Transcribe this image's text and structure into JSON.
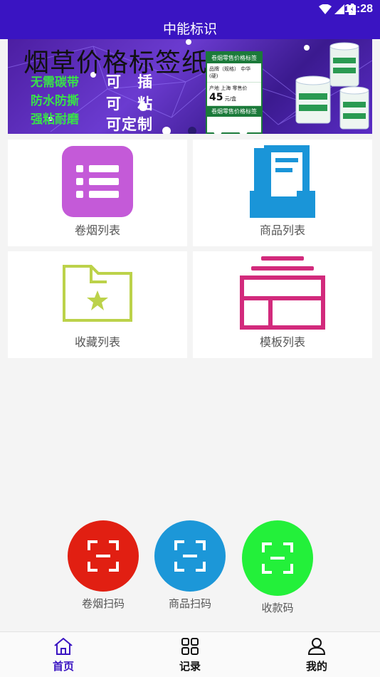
{
  "status_bar": {
    "time": "11:28",
    "icons": [
      "wifi-icon",
      "cellular-icon",
      "battery-icon"
    ]
  },
  "app_bar": {
    "title": "中能标识"
  },
  "banner": {
    "title": "烟草价格标签纸",
    "features": [
      "无需碳带",
      "防水防撕",
      "强粘耐磨"
    ],
    "uses": [
      "可 插",
      "可 粘",
      "可定制"
    ],
    "label_sample": {
      "header": "卷烟零售价格标签",
      "brand_label": "品牌（规格）",
      "brand": "中华(硬)",
      "origin_label": "产地",
      "origin": "上海",
      "price_label": "零售价",
      "price": "45",
      "unit": "元/盒",
      "header2": "卷烟零售价格标签"
    },
    "slides": 4,
    "active_slide": 2
  },
  "grid": [
    {
      "label": "卷烟列表",
      "icon": "list-icon",
      "color": "#c45ad8"
    },
    {
      "label": "商品列表",
      "icon": "inbox-tray-icon",
      "color": "#1a95d8"
    },
    {
      "label": "收藏列表",
      "icon": "folder-star-icon",
      "color": "#bcd24a"
    },
    {
      "label": "模板列表",
      "icon": "layout-template-icon",
      "color": "#d22a7c"
    }
  ],
  "scan_buttons": [
    {
      "label": "卷烟扫码",
      "color": "#e11f12"
    },
    {
      "label": "商品扫码",
      "color": "#1c97d8"
    },
    {
      "label": "收款码",
      "color": "#23f03a"
    }
  ],
  "tabs": [
    {
      "label": "首页",
      "icon": "home-icon",
      "active": true
    },
    {
      "label": "记录",
      "icon": "grid-icon",
      "active": false
    },
    {
      "label": "我的",
      "icon": "user-icon",
      "active": false
    }
  ],
  "colors": {
    "primary": "#3a14c2",
    "background": "#f4f4f4"
  }
}
